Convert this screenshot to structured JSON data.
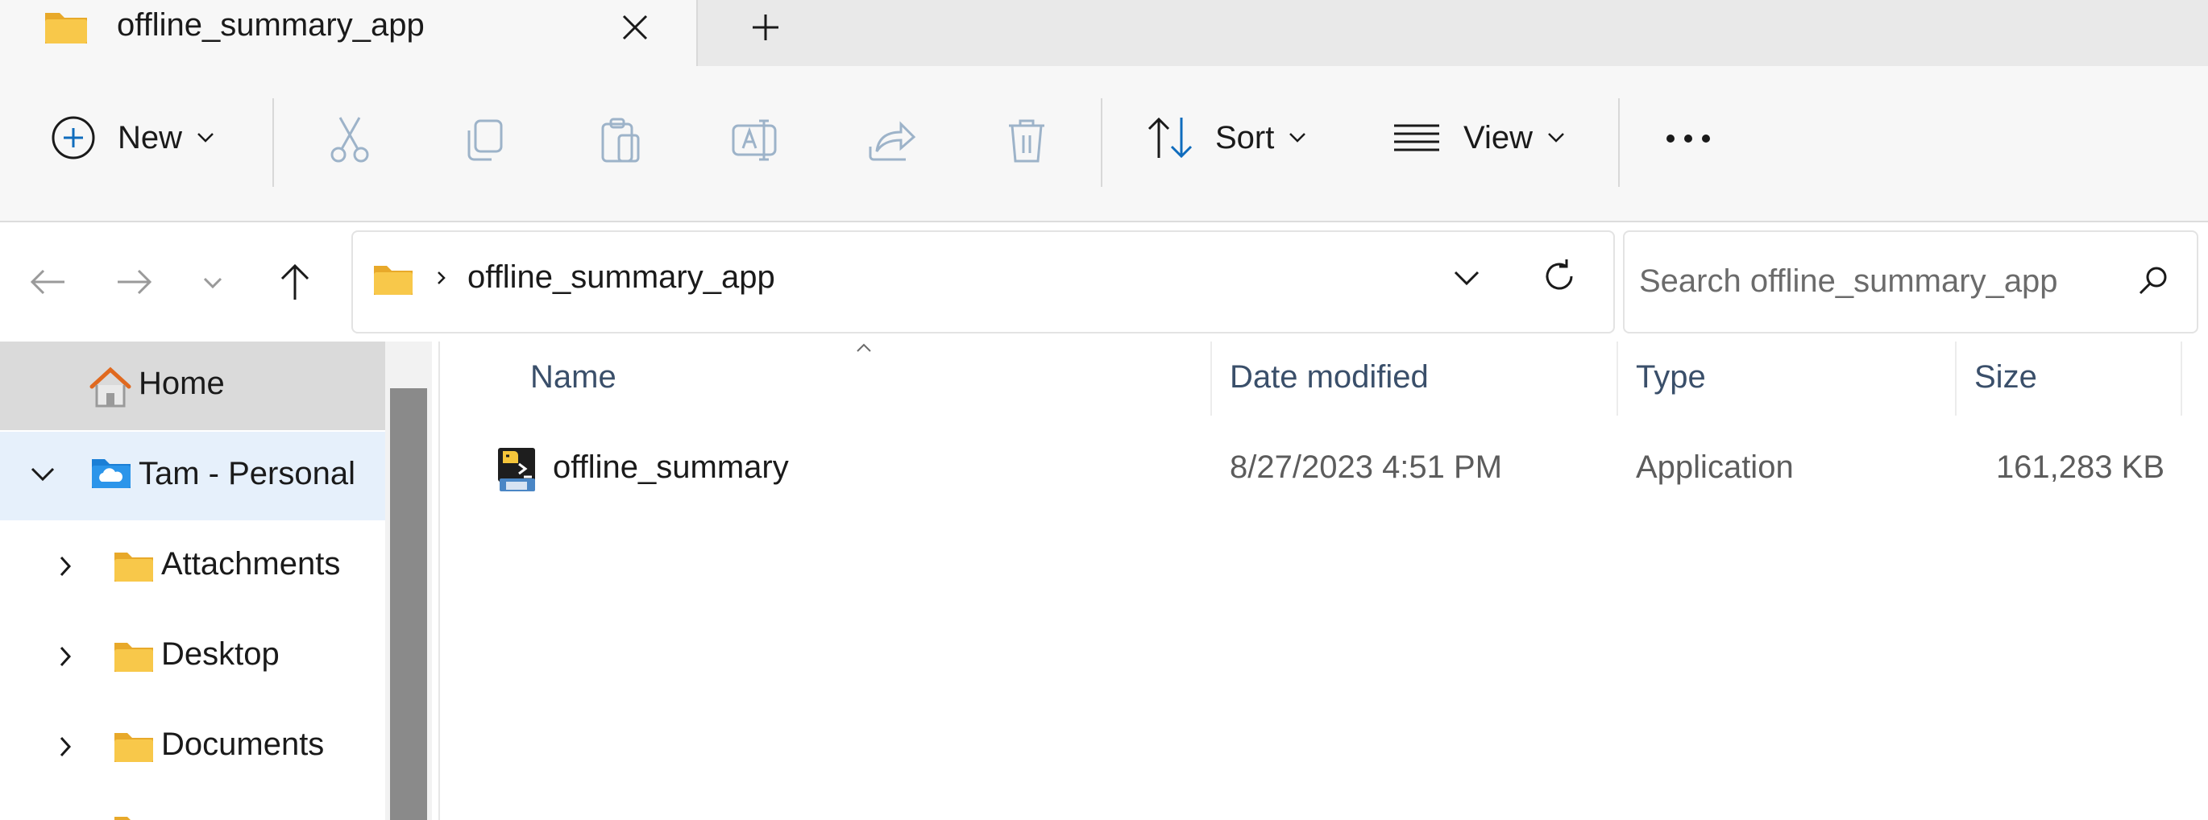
{
  "tab": {
    "title": "offline_summary_app"
  },
  "toolbar": {
    "new_label": "New",
    "sort_label": "Sort",
    "view_label": "View",
    "icons": [
      "cut-icon",
      "copy-icon",
      "paste-icon",
      "rename-icon",
      "share-icon",
      "delete-icon"
    ],
    "more_label": "•••"
  },
  "address": {
    "path_segment": "offline_summary_app",
    "search_placeholder": "Search offline_summary_app"
  },
  "sidebar": {
    "items": [
      {
        "label": "Home"
      },
      {
        "label": "Tam - Personal"
      },
      {
        "label": "Attachments"
      },
      {
        "label": "Desktop"
      },
      {
        "label": "Documents"
      }
    ]
  },
  "files": {
    "columns": [
      "Name",
      "Date modified",
      "Type",
      "Size"
    ],
    "rows": [
      {
        "name": "offline_summary",
        "date_modified": "8/27/2023 4:51 PM",
        "type": "Application",
        "size": "161,283 KB"
      }
    ]
  },
  "colors": {
    "accent": "#0f6cbd",
    "selected_home": "#dadada",
    "selected_onedrive": "#e6f0fb",
    "folder": "#f8c84a"
  }
}
